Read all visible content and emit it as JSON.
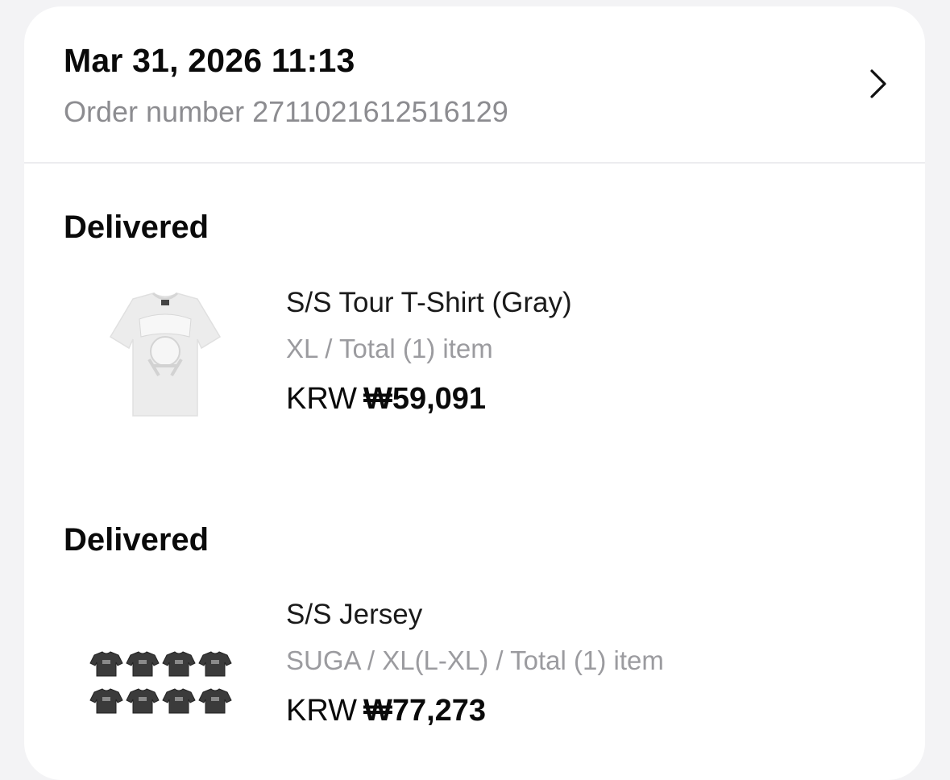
{
  "order": {
    "date": "Mar 31, 2026 11:13",
    "number_label": "Order number 2711021612516129"
  },
  "items": [
    {
      "status": "Delivered",
      "name": "S/S Tour T-Shirt (Gray)",
      "options": "XL / Total (1) item",
      "currency": "KRW",
      "price": "₩59,091",
      "thumbnail_icon": "gray-tshirt-image"
    },
    {
      "status": "Delivered",
      "name": "S/S Jersey",
      "options": "SUGA / XL(L-XL) / Total (1) item",
      "currency": "KRW",
      "price": "₩77,273",
      "thumbnail_icon": "jersey-grid-image"
    }
  ],
  "colors": {
    "text_primary": "#0a0a0a",
    "text_secondary": "#8c8c90",
    "page_bg": "#f3f3f5",
    "card_bg": "#ffffff"
  }
}
